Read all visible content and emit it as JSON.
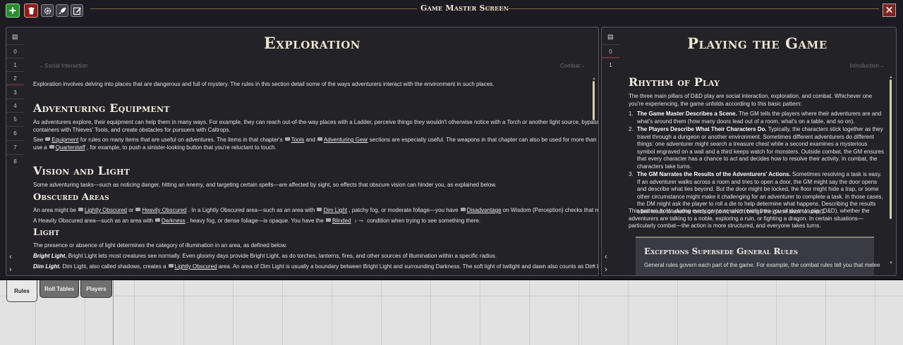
{
  "topbar": {
    "title": "Game Master Screen",
    "add_glyph": "+",
    "close_glyph": "✕",
    "icons": [
      "plus-icon",
      "trash-icon",
      "gear-icon",
      "rocket-icon",
      "edit-icon",
      "close-icon"
    ]
  },
  "panel_left": {
    "toc_icon": "▤",
    "toc_items": [
      "0",
      "1",
      "2",
      "3",
      "4",
      "5",
      "6",
      "7",
      "8"
    ],
    "prev_glyph": "‹",
    "next_glyph": "›",
    "title": "Exploration",
    "prev_link": "←Social Interaction",
    "next_link": "Combat→",
    "intro": "Exploration involves delving into places that are dangerous and full of mystery. The rules in this section detail some of the ways adventurers interact with the environment in such places.",
    "h_equipment": "Adventuring Equipment",
    "equip_p1_l1": "As adventurers explore, their equipment can help them in many ways. For example, they can reach out-of-the-way places with a Ladder, perceive things they wouldn't otherwise notice with a Torch or another light source, bypass locked doors and",
    "equip_p1_l2": "containers with Thieves' Tools, and create obstacles for pursuers with Caltrops.",
    "equip_p2_a": "See",
    "equip_p2_link1": "Equipment",
    "equip_p2_b": "for rules on many items that are useful on adventures. The items in that chapter's",
    "equip_p2_link2": "Tools",
    "equip_p2_c": "and",
    "equip_p2_link3": "Adventuring Gear",
    "equip_p2_d": "sections are especially useful. The weapons in that chapter can also be used for more than battle; you could",
    "equip_p3_a": "use a",
    "equip_p3_link": "Quarterstaff",
    "equip_p3_b": ", for example, to push a sinister-looking button that you're reluctant to touch.",
    "h_vision": "Vision and Light",
    "vision_p": "Some adventuring tasks—such as noticing danger, hitting an enemy, and targeting certain spells—are affected by sight, so effects that obscure vision can hinder you, as explained below.",
    "h_obscured": "Obscured Areas",
    "obs_l1_a": "An area might be",
    "obs_l1_link1": "Lightly Obscured",
    "obs_l1_b": "or",
    "obs_l1_link2": "Heavily Obscured",
    "obs_l1_c": ". In a Lightly Obscured area—such as an area with",
    "obs_l1_link3": "Dim Light",
    "obs_l1_d": ", patchy fog, or moderate foliage—you have",
    "obs_l1_link4": "Disadvantage",
    "obs_l1_e": "on Wisdom (Perception) checks that rely on sight.",
    "obs_l2_a": "A Heavily Obscured area—such as an area with",
    "obs_l2_link1": "Darkness",
    "obs_l2_b": ", heavy fog, or dense foliage—is opaque. You have the",
    "obs_l2_link2": "Blinded",
    "obs_l2_c": "condition when trying to see something there.",
    "h_light": "Light",
    "light_p": "The presence or absence of light determines the category of illumination in an area, as defined below.",
    "bright_label": "Bright Light.",
    "bright_text": "Bright Light lets most creatures see normally. Even gloomy days provide Bright Light, as do torches, lanterns, fires, and other sources of illumination within a specific radius.",
    "dim_label": "Dim Light.",
    "dim_a": "Dim Light, also called shadows, creates a",
    "dim_link": "Lightly Obscured",
    "dim_b": "area. An area of Dim Light is usually a boundary between Bright Light and surrounding Darkness. The soft light of twilight and dawn also counts as Dim Light. A full moon"
  },
  "panel_right": {
    "toc_icon": "▤",
    "toc_items": [
      "0",
      "1"
    ],
    "prev_glyph": "‹",
    "next_glyph": "›",
    "title": "Playing the Game",
    "next_link": "Introduction→",
    "h_rhythm": "Rhythm of Play",
    "rhythm_intro": "The three main pillars of D&D play are social interaction, exploration, and combat. Whichever one you're experiencing, the game unfolds according to this basic pattern:",
    "steps": [
      {
        "num": "1.",
        "label": "The Game Master Describes a Scene.",
        "text": "The GM tells the players where their adventurers are and what's around them (how many doors lead out of a room, what's on a table, and so on)."
      },
      {
        "num": "2.",
        "label": "The Players Describe What Their Characters Do.",
        "text": "Typically, the characters stick together as they travel through a dungeon or another environment. Sometimes different adventurers do different things: one adventurer might search a treasure chest while a second examines a mysterious symbol engraved on a wall and a third keeps watch for monsters. Outside combat, the GM ensures that every character has a chance to act and decides how to resolve their activity. In combat, the characters take turns."
      },
      {
        "num": "3.",
        "label": "The GM Narrates the Results of the Adventurers' Actions.",
        "text": "Sometimes resolving a task is easy. If an adventurer walks across a room and tries to open a door, the GM might say the door opens and describe what lies beyond. But the door might be locked, the floor might hide a trap, or some other circumstance might make it challenging for an adventurer to complete a task. In those cases, the DM might ask the player to roll a die to help determine what happens. Describing the results often leads to another decision point, which brings the game back to step 1."
      }
    ],
    "pattern_text": "This pattern holds during every game session (each time you sit down to play D&D), whether the adventurers are talking to a noble, exploring a ruin, or fighting a dragon. In certain situations—particularly combat—the action is more structured, and everyone takes turns.",
    "box_title": "Exceptions Supersede General Rules",
    "box_text": "General rules govern each part of the game. For example, the combat rules tell you that melee"
  },
  "bottom_tabs": [
    "Rules",
    "Roll Tables",
    "Players"
  ]
}
